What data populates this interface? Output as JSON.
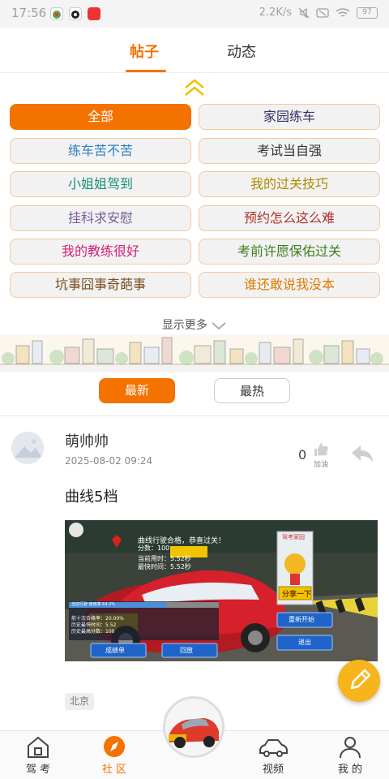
{
  "status_bar": {
    "time": "17:56",
    "network_speed": "2.2K/s",
    "battery": "97"
  },
  "top_tabs": [
    {
      "label": "帖子",
      "active": true
    },
    {
      "label": "动态",
      "active": false
    }
  ],
  "categories": [
    {
      "label": "全部",
      "color": "#ffffff",
      "active": true
    },
    {
      "label": "家园练车",
      "color": "#333366",
      "active": false
    },
    {
      "label": "练车苦不苦",
      "color": "#2e7fbe",
      "active": false
    },
    {
      "label": "考试当自强",
      "color": "#333333",
      "active": false
    },
    {
      "label": "小姐姐驾到",
      "color": "#1a8f7a",
      "active": false
    },
    {
      "label": "我的过关技巧",
      "color": "#b08a00",
      "active": false
    },
    {
      "label": "挂科求安慰",
      "color": "#7b5e9a",
      "active": false
    },
    {
      "label": "预约怎么这么难",
      "color": "#b0302a",
      "active": false
    },
    {
      "label": "我的教练很好",
      "color": "#d3207a",
      "active": false
    },
    {
      "label": "考前许愿保佑过关",
      "color": "#3e7d1e",
      "active": false
    },
    {
      "label": "坑事囧事奇葩事",
      "color": "#7a4f1c",
      "active": false
    },
    {
      "label": "谁还敢说我没本",
      "color": "#e07a00",
      "active": false
    }
  ],
  "show_more": "显示更多",
  "sort": {
    "latest": "最新",
    "hottest": "最热"
  },
  "post": {
    "author": "萌帅帅",
    "date": "2025-08-02 09:24",
    "like_count": "0",
    "like_label": "加油",
    "title": "曲线5档",
    "image": {
      "result_line1": "曲线行驶合格，恭喜过关！",
      "score": "分数：100",
      "time_used": "当前用时：5.52秒",
      "best_time": "最快时间：5.52秒",
      "progress_label": "当前行驶 使用率 64.2%",
      "stat1": "前十次合格率：20.00%",
      "stat2": "历史最快时间：5.52",
      "stat3": "历史最高分数：100",
      "badge_title": "驾考家园",
      "share_btn": "分享一下",
      "restart_btn": "重新开始",
      "exit_btn": "退出",
      "report_btn": "成绩单",
      "replay_btn": "回放"
    },
    "location": "北京"
  },
  "bottom_nav": [
    {
      "label": "驾 考",
      "icon": "home-icon",
      "active": false
    },
    {
      "label": "社 区",
      "icon": "compass-icon",
      "active": true
    },
    {
      "label": "视频",
      "icon": "car-icon",
      "active": false
    },
    {
      "label": "我 的",
      "icon": "person-icon",
      "active": false
    }
  ],
  "colors": {
    "accent": "#f47200",
    "fab": "#f6b51c"
  }
}
